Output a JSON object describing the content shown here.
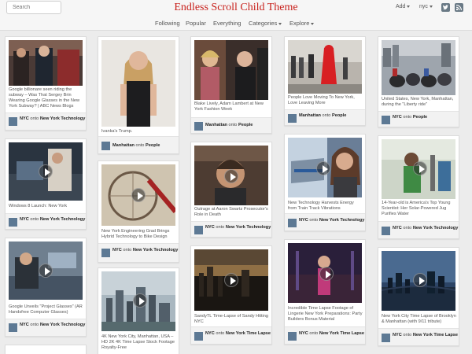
{
  "header": {
    "search_placeholder": "Search",
    "site_title": "Endless Scroll Child Theme",
    "add_label": "Add",
    "user_label": "nyc",
    "icons": [
      "twitter-icon",
      "rss-icon"
    ]
  },
  "nav": {
    "items": [
      "Following",
      "Popular",
      "Everything",
      "Categories",
      "Explore"
    ]
  },
  "colors": {
    "title_red": "#c8211c",
    "avatar_blue": "#5d7994",
    "page_bg": "#ececec"
  },
  "pins": [
    {
      "description": "Google billionare seen riding the subway – Was That Sergey Brin Wearing Google Glasses in the New York Subway? | ABC News Blogs",
      "user": "NYC",
      "onto": "onto",
      "board": "New York Technology",
      "video": false
    },
    {
      "description": "Windows 8 Launch: New York",
      "user": "NYC",
      "onto": "onto",
      "board": "New York Technology",
      "video": true
    },
    {
      "description": "Google Unveils \"Project Glasses\" (AR Handsfree Computer Glasses)",
      "user": "NYC",
      "onto": "onto",
      "board": "New York Technology",
      "video": true
    },
    {
      "description": "Ivanka's Trump.",
      "user": "Manhattan",
      "onto": "onto",
      "board": "People",
      "video": false
    },
    {
      "description": "New York Engineering Grad Brings Hybrid Technology to Bike Design",
      "user": "NYC",
      "onto": "onto",
      "board": "New York Technology",
      "video": true
    },
    {
      "description": "4K New York City, Manhattan, USA – HD 2K 4K Time Lapse Stock Footage Royalty-Free",
      "user": "",
      "onto": "",
      "board": "",
      "video": true
    },
    {
      "description": "Blake Lively, Adam Lambert at New York Fashion Week",
      "user": "Manhattan",
      "onto": "onto",
      "board": "People",
      "video": false
    },
    {
      "description": "Outrage at Aaron Swartz Prosecutor's Role in Death",
      "user": "NYC",
      "onto": "onto",
      "board": "New York Technology",
      "video": true
    },
    {
      "description": "SandyTL Time-Lapse of Sandy Hitting NYC",
      "user": "NYC",
      "onto": "onto",
      "board": "New York Time Lapse",
      "video": true
    },
    {
      "description": "People Love Moving To New York, Love Leaving More",
      "user": "Manhattan",
      "onto": "onto",
      "board": "People",
      "video": false
    },
    {
      "description": "New Technology Harvests Energy from Train Track Vibrations",
      "user": "NYC",
      "onto": "onto",
      "board": "New York Technology",
      "video": true
    },
    {
      "description": "Incredible Time Lapse Footage of Lingerie New York Preparations: Party Builders Bonus Material",
      "user": "NYC",
      "onto": "onto",
      "board": "New York Time Lapse",
      "video": true
    },
    {
      "description": "United States, New York, Manhattan, during the \"Liberty ride\"",
      "user": "NYC",
      "onto": "onto",
      "board": "People",
      "video": false
    },
    {
      "description": "14-Year-old is America's Top Young Scientist: Her Solar-Powered Jug Purifies Water",
      "user": "NYC",
      "onto": "onto",
      "board": "New York Technology",
      "video": true
    },
    {
      "description": "New York City Time Lapse of Brooklyn & Manhattan (with 9/11 tribute)",
      "user": "NYC",
      "onto": "onto",
      "board": "New York Time Lapse",
      "video": true
    }
  ]
}
